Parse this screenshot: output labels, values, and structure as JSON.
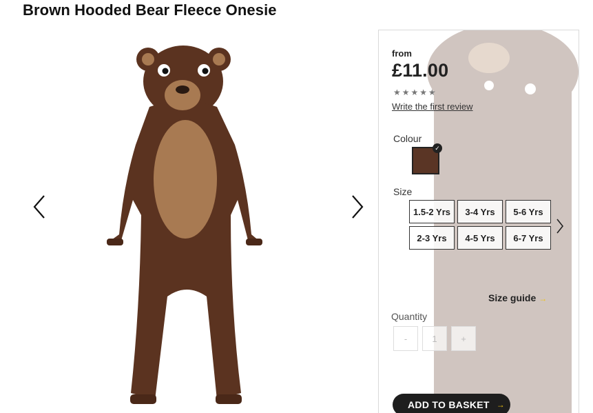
{
  "product": {
    "title": "Brown Hooded Bear Fleece Onesie"
  },
  "gallery": {
    "prev_icon": "chevron-left-icon",
    "next_icon": "chevron-right-icon",
    "image_alt": "bear-onesie-image"
  },
  "pricing": {
    "from_label": "from",
    "price": "£11.00",
    "stars": "★★★★★",
    "rating": 0,
    "review_link": "Write the first review"
  },
  "colour": {
    "label": "Colour",
    "selected": "#5a3525",
    "check_icon": "check-icon"
  },
  "size": {
    "label": "Size",
    "options": [
      "1.5-2 Yrs",
      "3-4 Yrs",
      "5-6 Yrs",
      "2-3 Yrs",
      "4-5 Yrs",
      "6-7 Yrs"
    ],
    "next_icon": "chevron-right-icon"
  },
  "size_guide": {
    "label": "Size guide",
    "arrow": "→"
  },
  "quantity": {
    "label": "Quantity",
    "minus": "-",
    "value": "1",
    "plus": "+"
  },
  "basket": {
    "label": "ADD TO BASKET",
    "arrow": "→"
  },
  "colors": {
    "fur": "#5b3320",
    "belly": "#a87a52",
    "accent": "#f0c30f",
    "button": "#1e1e1e"
  }
}
